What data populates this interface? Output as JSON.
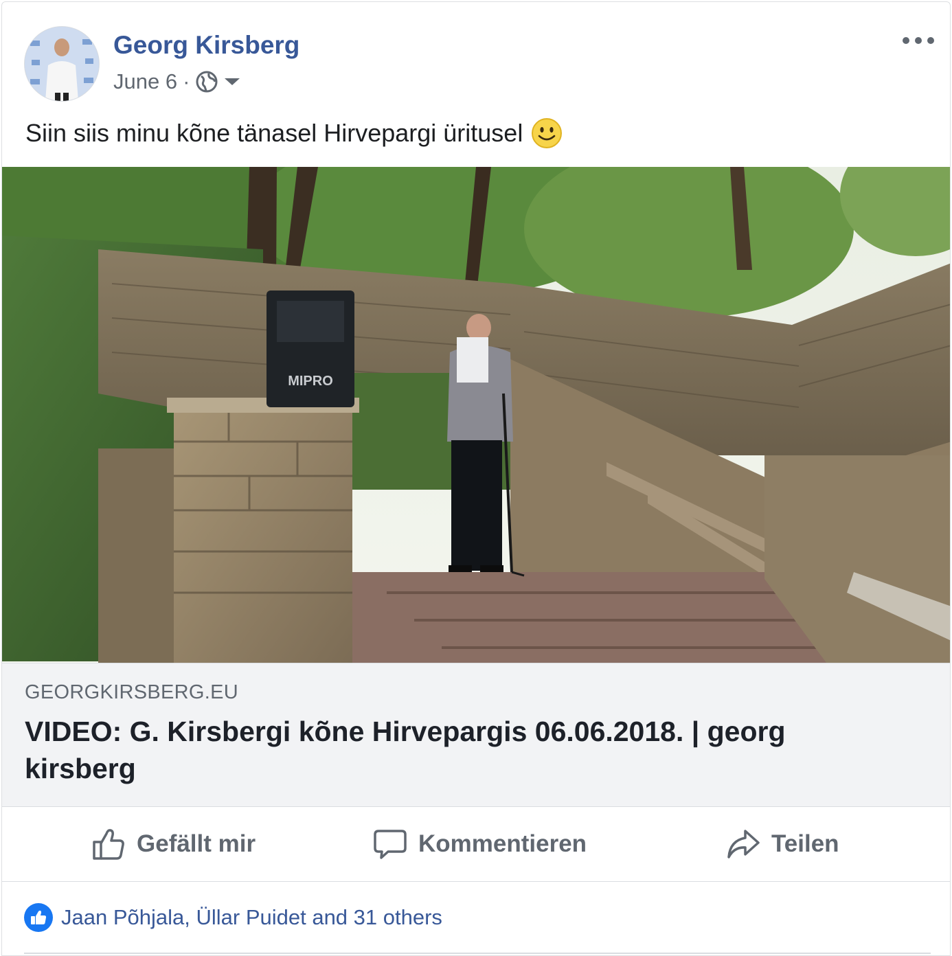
{
  "post": {
    "author": "Georg Kirsberg",
    "date": "June 6",
    "separator": "·",
    "caption": "Siin siis minu kõne tänasel Hirvepargi üritusel",
    "caption_emoji": "smiling-face-icon"
  },
  "media": {
    "speaker_label": "MIPRO"
  },
  "link": {
    "domain": "GEORGKIRSBERG.EU",
    "title": "VIDEO: G. Kirsbergi kõne Hirvepargis 06.06.2018. | georg kirsberg"
  },
  "actions": {
    "like_label": "Gefällt mir",
    "comment_label": "Kommentieren",
    "share_label": "Teilen"
  },
  "reactions": {
    "summary": "Jaan Põhjala, Üllar Puidet and 31 others"
  },
  "colors": {
    "author_link": "#385898",
    "like_blue": "#1877f2",
    "muted_text": "#606770",
    "link_box_bg": "#f2f3f5"
  }
}
